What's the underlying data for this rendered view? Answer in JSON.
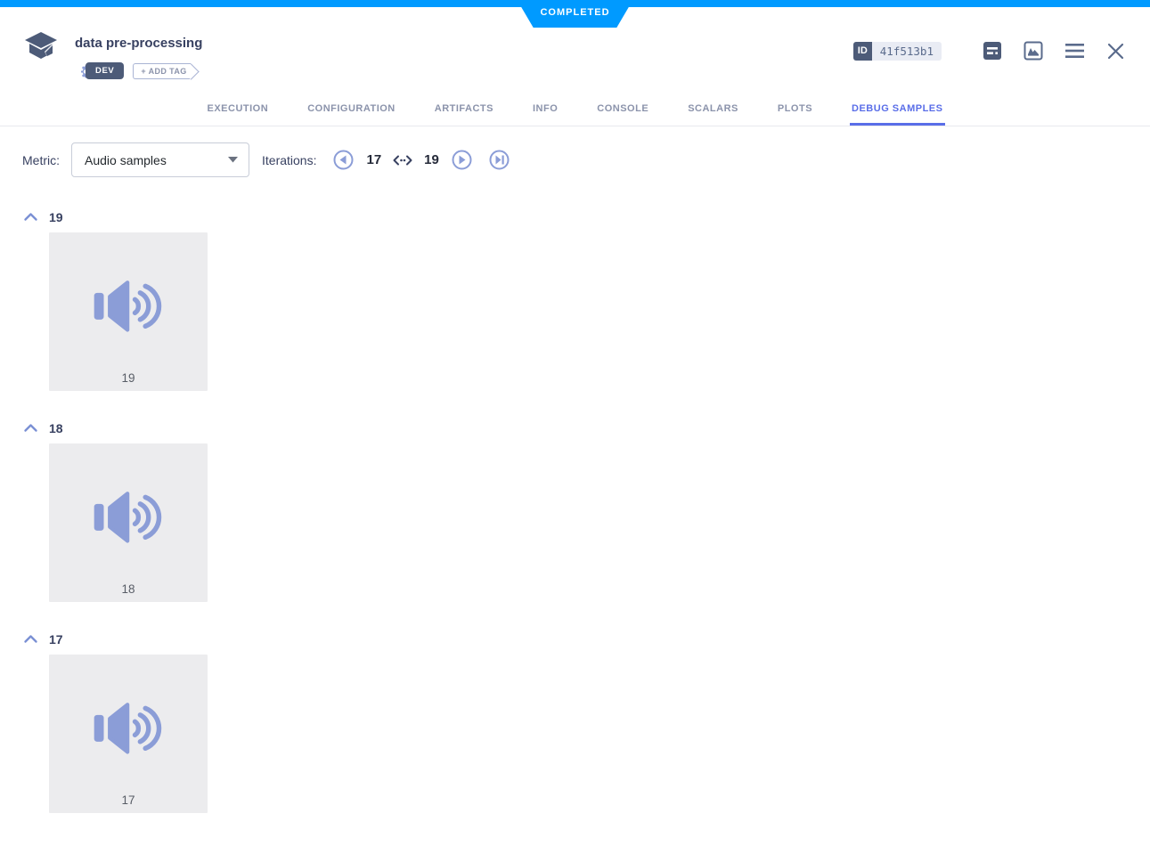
{
  "status_ribbon": "COMPLETED",
  "header": {
    "title": "data pre-processing",
    "tag": "DEV",
    "add_tag_label": "+ ADD TAG",
    "id_label": "ID",
    "id_value": "41f513b1"
  },
  "tabs": {
    "execution": "EXECUTION",
    "configuration": "CONFIGURATION",
    "artifacts": "ARTIFACTS",
    "info": "INFO",
    "console": "CONSOLE",
    "scalars": "SCALARS",
    "plots": "PLOTS",
    "debug_samples": "DEBUG SAMPLES",
    "active": "DEBUG SAMPLES"
  },
  "toolbar": {
    "metric_label": "Metric:",
    "metric_value": "Audio samples",
    "iterations_label": "Iterations:",
    "iteration_min": "17",
    "iteration_max": "19"
  },
  "sections": [
    {
      "iteration": "19",
      "caption": "19",
      "media_type": "audio"
    },
    {
      "iteration": "18",
      "caption": "18",
      "media_type": "audio"
    },
    {
      "iteration": "17",
      "caption": "17",
      "media_type": "audio"
    }
  ],
  "colors": {
    "status_blue": "#009aff",
    "active_tab_blue": "#5a6ee8",
    "dark_slate": "#384161",
    "slate": "#5a6b8c",
    "badge_slate": "#4d5b78",
    "periwinkle": "#8b9dd7",
    "inactive_tab": "#8b93ab",
    "card_background": "#ececee"
  }
}
